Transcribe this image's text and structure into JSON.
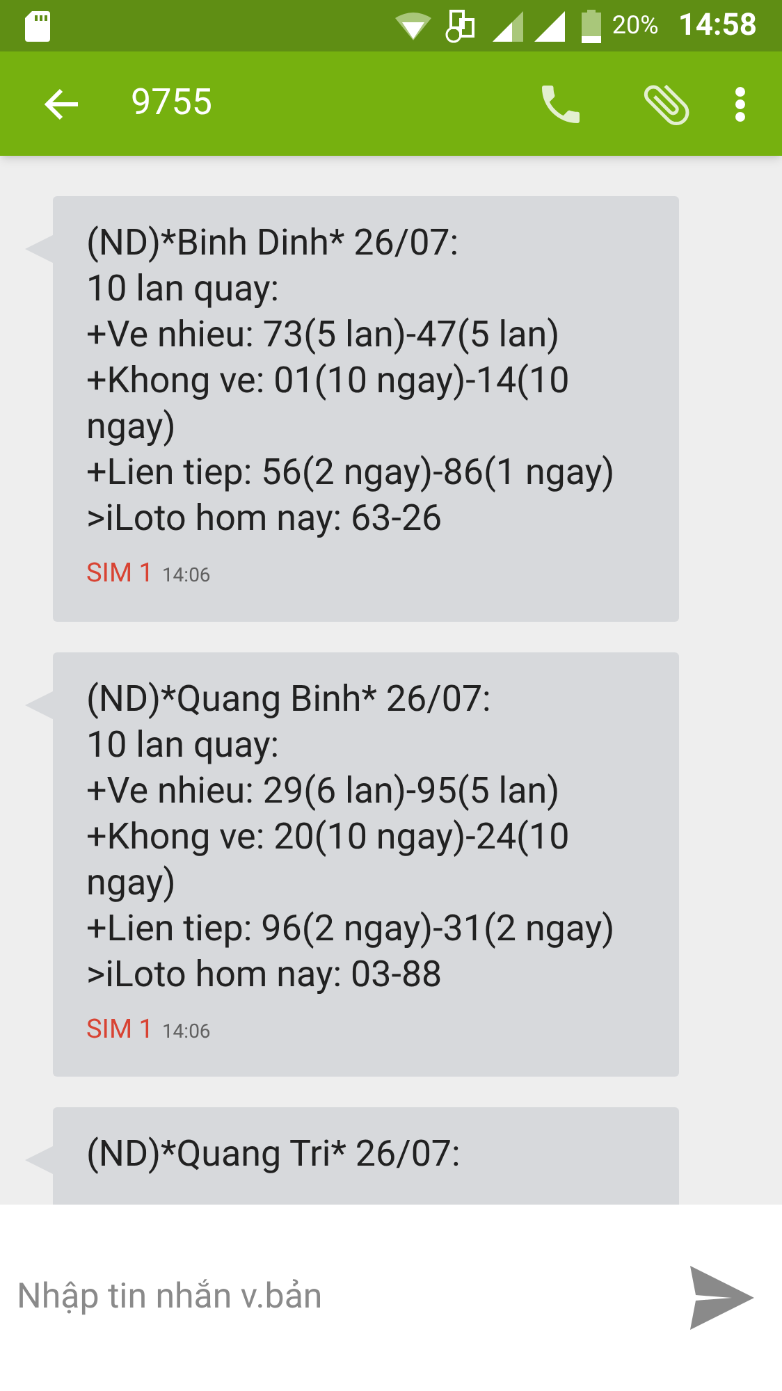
{
  "status_bar": {
    "battery": "20%",
    "time": "14:58"
  },
  "app_bar": {
    "title": "9755"
  },
  "messages": [
    {
      "body": "(ND)*Binh Dinh* 26/07:\n10 lan quay:\n+Ve nhieu: 73(5 lan)-47(5 lan)\n+Khong ve: 01(10 ngay)-14(10 ngay)\n+Lien tiep: 56(2 ngay)-86(1 ngay)\n>iLoto hom nay: 63-26",
      "sim": "SIM 1",
      "time": "14:06"
    },
    {
      "body": "(ND)*Quang Binh* 26/07:\n10 lan quay:\n+Ve nhieu: 29(6 lan)-95(5 lan)\n+Khong ve: 20(10 ngay)-24(10 ngay)\n+Lien tiep: 96(2 ngay)-31(2 ngay)\n>iLoto hom nay: 03-88",
      "sim": "SIM 1",
      "time": "14:06"
    },
    {
      "body": "(ND)*Quang Tri* 26/07:"
    }
  ],
  "composer": {
    "placeholder": "Nhập tin nhắn v.bản"
  }
}
